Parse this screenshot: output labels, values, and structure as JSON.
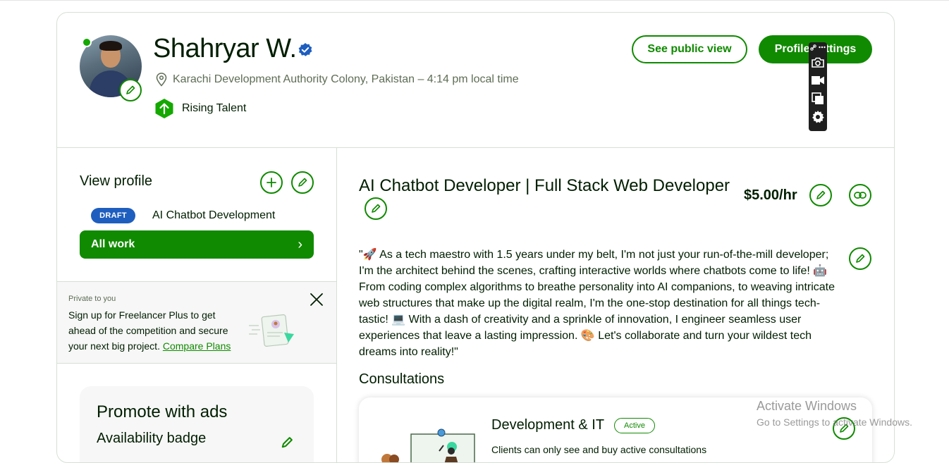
{
  "profile": {
    "name": "Shahryar W.",
    "location": "Karachi Development Authority Colony, Pakistan – 4:14 pm local time",
    "badge": "Rising Talent"
  },
  "header": {
    "public_view_label": "See public view",
    "settings_label": "Profile settings"
  },
  "sidebar": {
    "view_profile": "View profile",
    "draft_badge": "DRAFT",
    "draft_item": "AI Chatbot Development",
    "all_work": "All work",
    "all_work_chevron": "›"
  },
  "promo": {
    "small": "Private to you",
    "text": "Sign up for Freelancer Plus to get ahead of the competition and secure your next big project.",
    "link": "Compare Plans"
  },
  "ads": {
    "title": "Promote with ads",
    "subtitle": "Availability badge"
  },
  "main": {
    "title": "AI Chatbot Developer | Full Stack Web Developer",
    "rate": "$5.00/hr",
    "overview": "\"🚀 As a tech maestro with 1.5 years under my belt, I'm not just your run-of-the-mill developer; I'm the architect behind the scenes, crafting interactive worlds where chatbots come to life! 🤖 From coding complex algorithms to breathe personality into AI companions, to weaving intricate web structures that make up the digital realm, I'm the one-stop destination for all things tech-tastic! 💻 With a dash of creativity and a sprinkle of innovation, I engineer seamless user experiences that leave a lasting impression. 🎨 Let's collaborate and turn your wildest tech dreams into reality!\"",
    "consultations_title": "Consultations",
    "consultation": {
      "category": "Development & IT",
      "status": "Active",
      "description": "Clients can only see and buy active consultations"
    }
  },
  "watermark": {
    "line1": "Activate Windows",
    "line2": "Go to Settings to activate Windows."
  },
  "colors": {
    "brand_green": "#108a00",
    "draft_blue": "#1e5ebf",
    "verified_blue": "#1e5ebf",
    "text": "#001e00"
  },
  "icons": [
    "pencil-icon",
    "plus-icon",
    "link-icon",
    "map-pin-icon",
    "verified-icon",
    "arrow-up-icon",
    "close-icon",
    "camera-icon",
    "video-icon",
    "copy-icon",
    "gear-icon",
    "chevron-right-icon"
  ]
}
